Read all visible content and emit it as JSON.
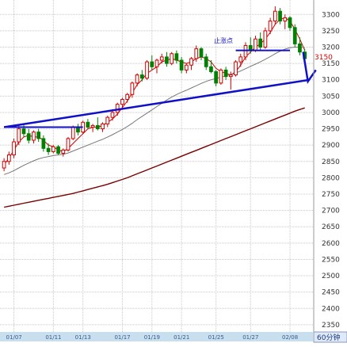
{
  "chart_data": {
    "type": "candlestick",
    "title": "",
    "period_label": "60分钟",
    "price_marker": "3150",
    "annotation": "止涨点",
    "y_ticks": [
      2350,
      2400,
      2450,
      2500,
      2550,
      2600,
      2650,
      2700,
      2750,
      2800,
      2850,
      2900,
      2950,
      3000,
      3050,
      3100,
      3150,
      3200,
      3250,
      3300
    ],
    "ylim": [
      2340,
      3325
    ],
    "x_ticks": [
      "01/07",
      "01/11",
      "01/13",
      "01/17",
      "01/19",
      "01/21",
      "01/25",
      "01/27",
      "02/08"
    ],
    "grid": true,
    "colors": {
      "up": "#d00000",
      "down": "#008000",
      "ma_fast": "#cc0000",
      "ma_mid": "#777777",
      "ma_slow": "#7a0000",
      "trend": "#1010c8",
      "axis_band": "#c8dff0"
    },
    "candles": [
      {
        "o": 2830,
        "h": 2860,
        "l": 2820,
        "c": 2850
      },
      {
        "o": 2850,
        "h": 2880,
        "l": 2840,
        "c": 2870
      },
      {
        "o": 2870,
        "h": 2920,
        "l": 2860,
        "c": 2910
      },
      {
        "o": 2910,
        "h": 2960,
        "l": 2900,
        "c": 2950
      },
      {
        "o": 2950,
        "h": 2965,
        "l": 2925,
        "c": 2935
      },
      {
        "o": 2935,
        "h": 2950,
        "l": 2905,
        "c": 2915
      },
      {
        "o": 2915,
        "h": 2945,
        "l": 2905,
        "c": 2940
      },
      {
        "o": 2940,
        "h": 2950,
        "l": 2910,
        "c": 2920
      },
      {
        "o": 2920,
        "h": 2930,
        "l": 2880,
        "c": 2890
      },
      {
        "o": 2890,
        "h": 2905,
        "l": 2870,
        "c": 2880
      },
      {
        "o": 2880,
        "h": 2900,
        "l": 2875,
        "c": 2895
      },
      {
        "o": 2895,
        "h": 2900,
        "l": 2870,
        "c": 2875
      },
      {
        "o": 2875,
        "h": 2890,
        "l": 2865,
        "c": 2885
      },
      {
        "o": 2885,
        "h": 2925,
        "l": 2880,
        "c": 2920
      },
      {
        "o": 2920,
        "h": 2960,
        "l": 2915,
        "c": 2955
      },
      {
        "o": 2955,
        "h": 2965,
        "l": 2930,
        "c": 2940
      },
      {
        "o": 2940,
        "h": 2975,
        "l": 2935,
        "c": 2970
      },
      {
        "o": 2970,
        "h": 2980,
        "l": 2950,
        "c": 2955
      },
      {
        "o": 2955,
        "h": 2965,
        "l": 2940,
        "c": 2960
      },
      {
        "o": 2960,
        "h": 2985,
        "l": 2945,
        "c": 2950
      },
      {
        "o": 2950,
        "h": 2970,
        "l": 2940,
        "c": 2965
      },
      {
        "o": 2965,
        "h": 2990,
        "l": 2955,
        "c": 2985
      },
      {
        "o": 2985,
        "h": 3010,
        "l": 2975,
        "c": 3000
      },
      {
        "o": 3000,
        "h": 3030,
        "l": 2990,
        "c": 3025
      },
      {
        "o": 3025,
        "h": 3045,
        "l": 3010,
        "c": 3040
      },
      {
        "o": 3040,
        "h": 3060,
        "l": 3030,
        "c": 3055
      },
      {
        "o": 3055,
        "h": 3095,
        "l": 3045,
        "c": 3090
      },
      {
        "o": 3090,
        "h": 3120,
        "l": 3080,
        "c": 3115
      },
      {
        "o": 3115,
        "h": 3130,
        "l": 3095,
        "c": 3105
      },
      {
        "o": 3105,
        "h": 3160,
        "l": 3100,
        "c": 3155
      },
      {
        "o": 3155,
        "h": 3175,
        "l": 3130,
        "c": 3140
      },
      {
        "o": 3140,
        "h": 3165,
        "l": 3120,
        "c": 3160
      },
      {
        "o": 3160,
        "h": 3180,
        "l": 3150,
        "c": 3170
      },
      {
        "o": 3170,
        "h": 3185,
        "l": 3140,
        "c": 3150
      },
      {
        "o": 3150,
        "h": 3185,
        "l": 3145,
        "c": 3180
      },
      {
        "o": 3180,
        "h": 3190,
        "l": 3150,
        "c": 3160
      },
      {
        "o": 3160,
        "h": 3170,
        "l": 3120,
        "c": 3130
      },
      {
        "o": 3130,
        "h": 3150,
        "l": 3120,
        "c": 3145
      },
      {
        "o": 3145,
        "h": 3170,
        "l": 3130,
        "c": 3165
      },
      {
        "o": 3165,
        "h": 3205,
        "l": 3155,
        "c": 3195
      },
      {
        "o": 3195,
        "h": 3200,
        "l": 3160,
        "c": 3170
      },
      {
        "o": 3170,
        "h": 3180,
        "l": 3130,
        "c": 3140
      },
      {
        "o": 3140,
        "h": 3160,
        "l": 3120,
        "c": 3125
      },
      {
        "o": 3125,
        "h": 3130,
        "l": 3080,
        "c": 3090
      },
      {
        "o": 3090,
        "h": 3135,
        "l": 3085,
        "c": 3130
      },
      {
        "o": 3130,
        "h": 3140,
        "l": 3100,
        "c": 3110
      },
      {
        "o": 3110,
        "h": 3125,
        "l": 3070,
        "c": 3115
      },
      {
        "o": 3115,
        "h": 3160,
        "l": 3110,
        "c": 3155
      },
      {
        "o": 3155,
        "h": 3180,
        "l": 3140,
        "c": 3170
      },
      {
        "o": 3170,
        "h": 3215,
        "l": 3160,
        "c": 3205
      },
      {
        "o": 3205,
        "h": 3230,
        "l": 3180,
        "c": 3190
      },
      {
        "o": 3190,
        "h": 3235,
        "l": 3185,
        "c": 3225
      },
      {
        "o": 3225,
        "h": 3245,
        "l": 3190,
        "c": 3200
      },
      {
        "o": 3200,
        "h": 3260,
        "l": 3195,
        "c": 3250
      },
      {
        "o": 3250,
        "h": 3290,
        "l": 3240,
        "c": 3280
      },
      {
        "o": 3280,
        "h": 3325,
        "l": 3270,
        "c": 3310
      },
      {
        "o": 3310,
        "h": 3320,
        "l": 3270,
        "c": 3280
      },
      {
        "o": 3280,
        "h": 3300,
        "l": 3255,
        "c": 3290
      },
      {
        "o": 3290,
        "h": 3295,
        "l": 3250,
        "c": 3260
      },
      {
        "o": 3260,
        "h": 3270,
        "l": 3200,
        "c": 3210
      },
      {
        "o": 3210,
        "h": 3230,
        "l": 3175,
        "c": 3185
      },
      {
        "o": 3185,
        "h": 3195,
        "l": 3150,
        "c": 3165
      }
    ],
    "series": [
      {
        "values": [
          2840,
          2860,
          2885,
          2910,
          2925,
          2930,
          2925,
          2925,
          2915,
          2900,
          2895,
          2885,
          2880,
          2890,
          2905,
          2920,
          2935,
          2950,
          2955,
          2955,
          2960,
          2970,
          2980,
          2995,
          3015,
          3035,
          3060,
          3085,
          3100,
          3120,
          3130,
          3140,
          3155,
          3160,
          3165,
          3160,
          3155,
          3150,
          3155,
          3165,
          3170,
          3165,
          3155,
          3135,
          3125,
          3120,
          3115,
          3125,
          3145,
          3170,
          3185,
          3200,
          3210,
          3225,
          3245,
          3270,
          3285,
          3290,
          3280,
          3255,
          3225,
          3190
        ]
      },
      {
        "values": [
          2810,
          2815,
          2822,
          2830,
          2838,
          2845,
          2852,
          2858,
          2862,
          2865,
          2868,
          2870,
          2872,
          2876,
          2882,
          2888,
          2894,
          2900,
          2906,
          2912,
          2918,
          2925,
          2932,
          2940,
          2948,
          2957,
          2967,
          2978,
          2988,
          2998,
          3008,
          3018,
          3028,
          3038,
          3047,
          3055,
          3062,
          3068,
          3075,
          3082,
          3089,
          3095,
          3100,
          3104,
          3108,
          3112,
          3116,
          3121,
          3127,
          3134,
          3141,
          3148,
          3155,
          3163,
          3171,
          3180,
          3188,
          3194,
          3198,
          3200,
          3200,
          3199
        ]
      },
      {
        "values": [
          2710,
          2713,
          2716,
          2719,
          2722,
          2725,
          2728,
          2731,
          2734,
          2737,
          2740,
          2743,
          2746,
          2749,
          2752,
          2756,
          2760,
          2764,
          2768,
          2772,
          2776,
          2780,
          2785,
          2790,
          2795,
          2800,
          2806,
          2812,
          2818,
          2824,
          2830,
          2836,
          2842,
          2848,
          2854,
          2860,
          2866,
          2872,
          2878,
          2884,
          2890,
          2896,
          2902,
          2908,
          2914,
          2920,
          2926,
          2932,
          2938,
          2944,
          2950,
          2956,
          2962,
          2968,
          2974,
          2980,
          2986,
          2992,
          2998,
          3004,
          3009,
          3014
        ]
      }
    ],
    "trend_lines": [
      {
        "from": [
          0,
          2955
        ],
        "to": [
          62,
          3100
        ]
      },
      {
        "from": [
          0,
          2955
        ],
        "to": [
          16,
          2955
        ]
      },
      {
        "from": [
          47,
          3190
        ],
        "to": [
          58,
          3190
        ]
      }
    ]
  }
}
